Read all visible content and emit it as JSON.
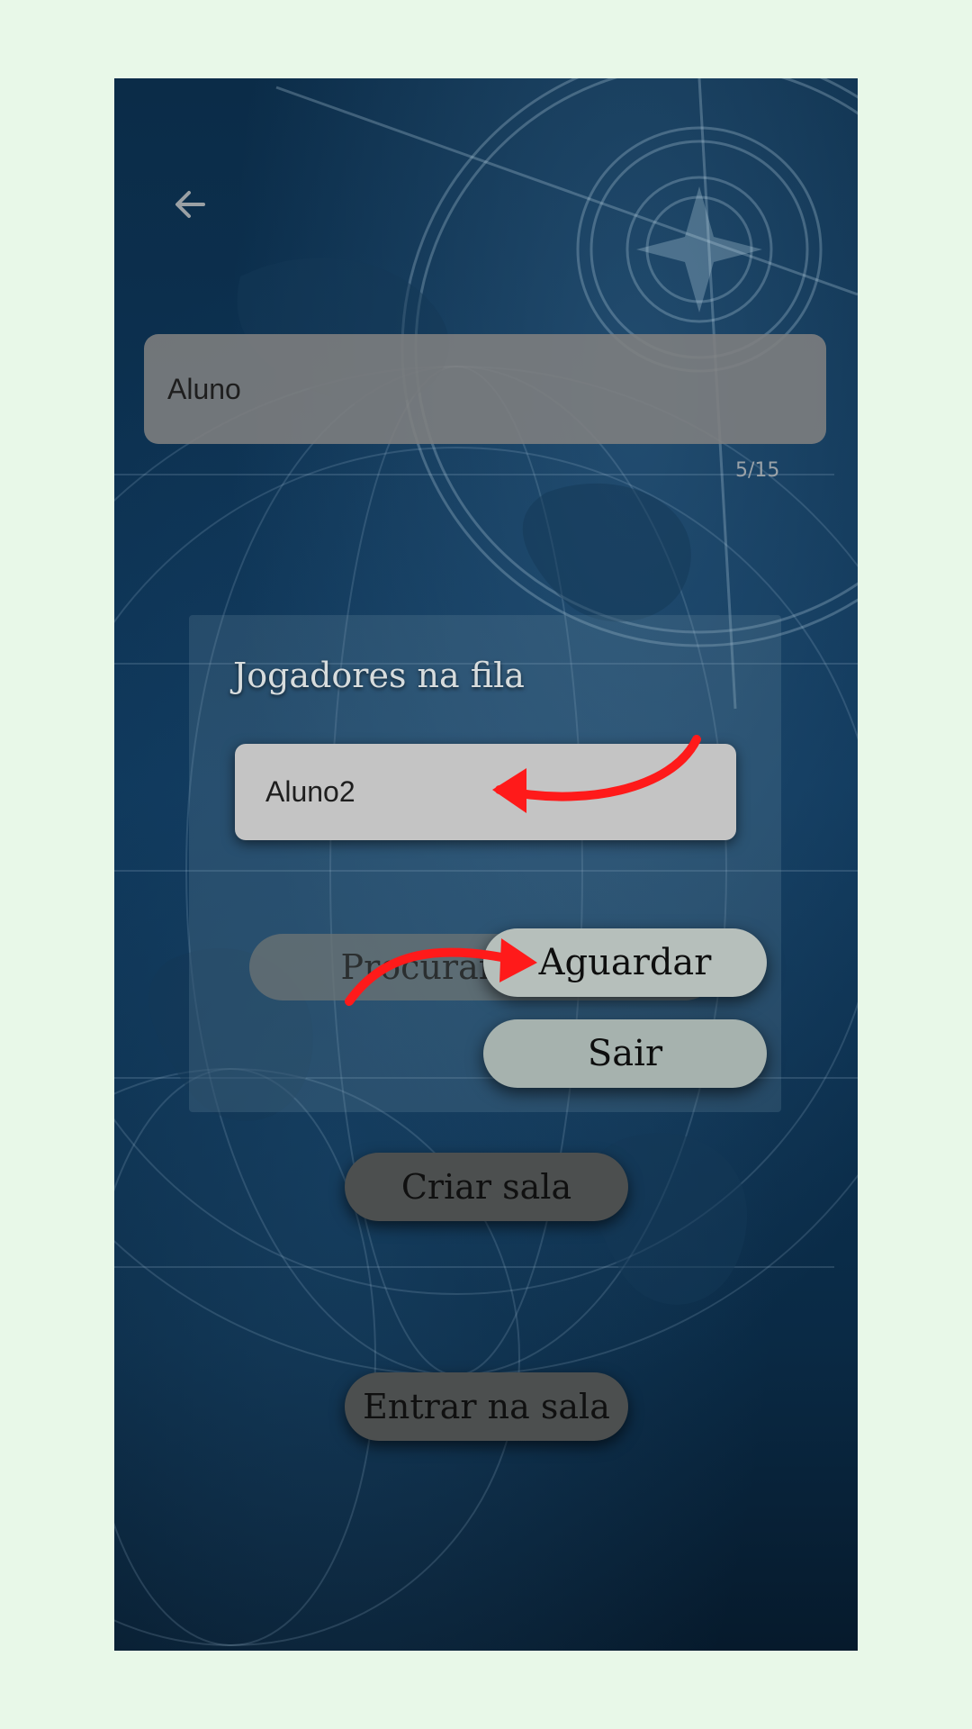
{
  "header": {
    "back_icon": "arrow-left-icon"
  },
  "name_field": {
    "value": "Aluno",
    "counter": "5/15"
  },
  "queue_panel": {
    "title": "Jogadores na fila",
    "players": [
      "Aluno2"
    ],
    "search_label": "Procurar u",
    "wait_label": "Aguardar",
    "exit_label": "Sair"
  },
  "actions": {
    "create_room": "Criar sala",
    "enter_room": "Entrar na sala"
  },
  "annotations": {
    "arrow_color": "#ff1a1a"
  }
}
